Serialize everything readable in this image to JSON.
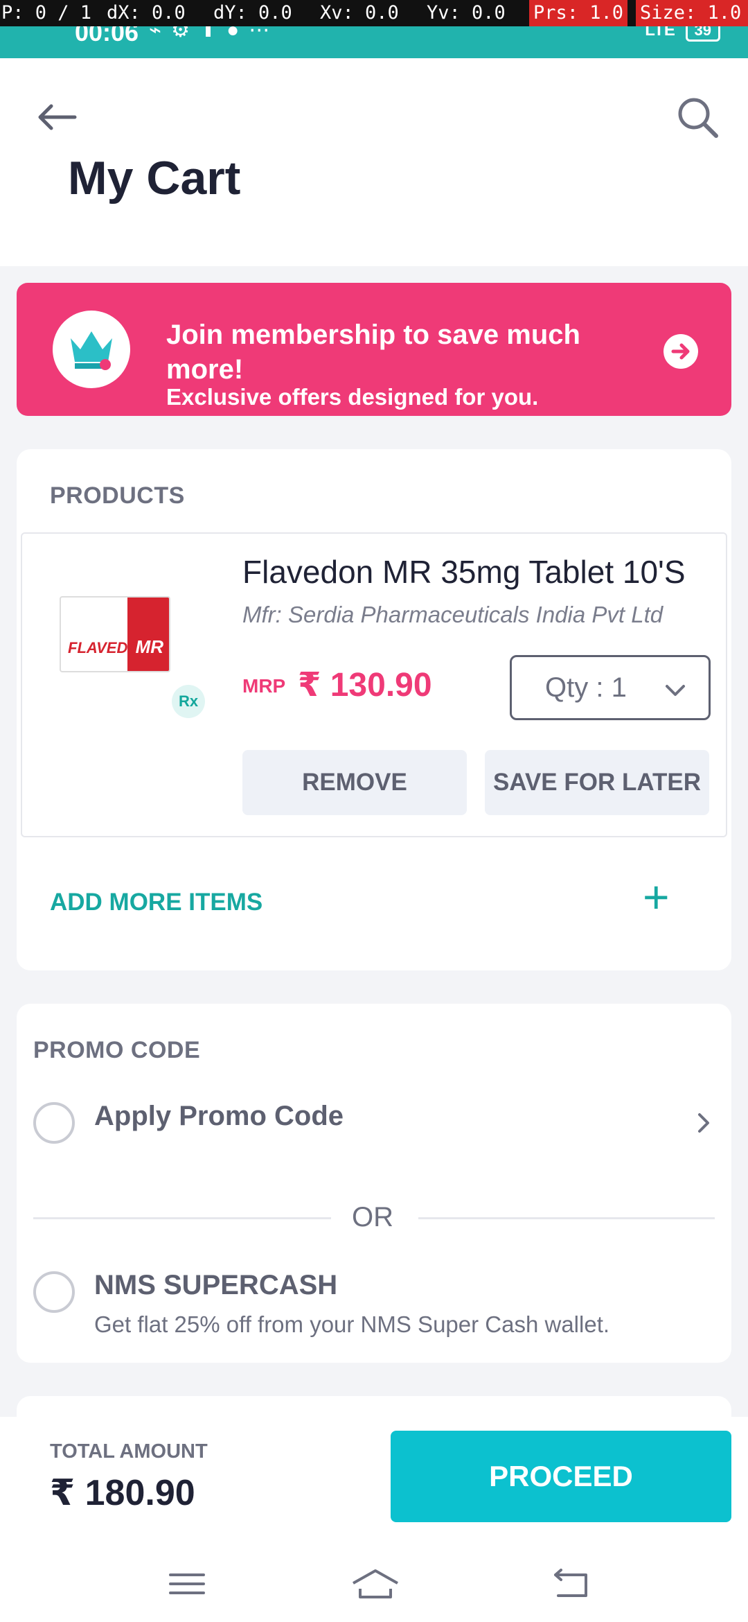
{
  "debug_overlay": {
    "p": "P: 0 / 1",
    "dx": "dX: 0.0",
    "dy": "dY: 0.0",
    "xv": "Xv: 0.0",
    "yv": "Yv: 0.0",
    "prs": "Prs: 1.0",
    "size": "Size: 1.0"
  },
  "status_bar": {
    "time": "00:06",
    "network": "LTE",
    "battery": "39",
    "icons": [
      "signal-icon",
      "usb-icon",
      "settings-icon",
      "upload-icon",
      "chat-icon",
      "more-icon"
    ]
  },
  "header": {
    "title": "My Cart"
  },
  "membership": {
    "title": "Join membership to save much more!",
    "subtitle": "Exclusive offers designed for you."
  },
  "products": {
    "section_label": "PRODUCTS",
    "items": [
      {
        "name": "Flavedon MR 35mg Tablet 10'S",
        "manufacturer": "Mfr:  Serdia Pharmaceuticals India Pvt Ltd",
        "mrp_label": "MRP",
        "price": "₹ 130.90",
        "rx_badge": "Rx",
        "qty_label": "Qty : 1",
        "remove_label": "REMOVE",
        "save_label": "SAVE FOR LATER",
        "image_brand": "FLAVEDON",
        "image_suffix": "MR"
      }
    ],
    "add_more_label": "ADD MORE ITEMS",
    "add_more_icon": "+"
  },
  "promo": {
    "section_label": "PROMO CODE",
    "apply_label": "Apply Promo Code",
    "or_label": "OR",
    "supercash_title": "NMS SUPERCASH",
    "supercash_desc": "Get flat 25% off from your NMS Super Cash wallet."
  },
  "checkout": {
    "total_label": "TOTAL AMOUNT",
    "total_value": "₹ 180.90",
    "proceed_label": "PROCEED"
  },
  "colors": {
    "primary_teal": "#0cc1cf",
    "accent_pink": "#ef3a77",
    "status_bar": "#21b3ad",
    "text_dark": "#1f2235"
  }
}
